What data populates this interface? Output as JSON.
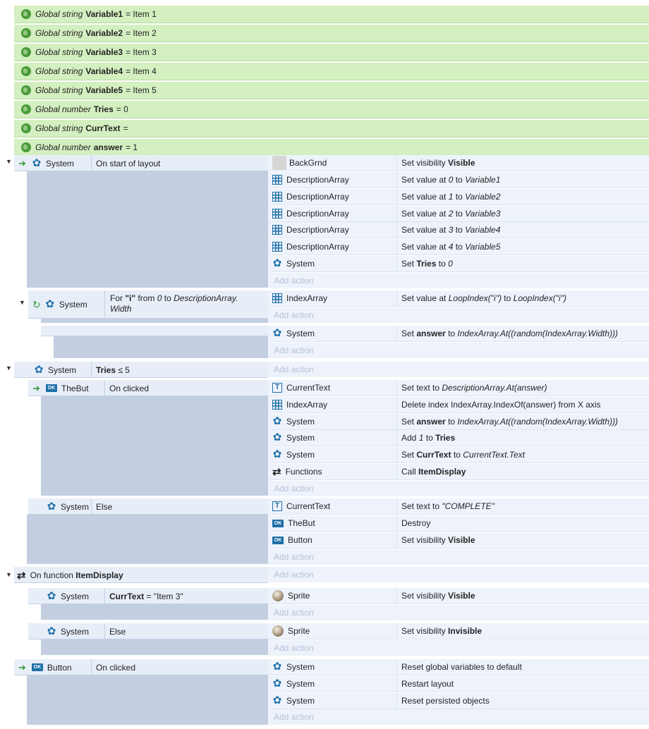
{
  "globals": [
    {
      "type": "Global string",
      "name": "Variable1",
      "value": "= Item 1"
    },
    {
      "type": "Global string",
      "name": "Variable2",
      "value": "= Item 2"
    },
    {
      "type": "Global string",
      "name": "Variable3",
      "value": "= Item 3"
    },
    {
      "type": "Global string",
      "name": "Variable4",
      "value": "= Item 4"
    },
    {
      "type": "Global string",
      "name": "Variable5",
      "value": "= Item 5"
    },
    {
      "type": "Global number",
      "name": "Tries",
      "value": "= 0"
    },
    {
      "type": "Global string",
      "name": "CurrText",
      "value": "="
    },
    {
      "type": "Global number",
      "name": "answer",
      "value": "= 1"
    }
  ],
  "labels": {
    "system": "System",
    "add_action": "Add action",
    "else": "Else",
    "on_clicked": "On clicked",
    "on_start": "On start of layout",
    "thebut": "TheBut",
    "button": "Button",
    "on_function": "On function",
    "item_display": "ItemDisplay",
    "for_pre": "For",
    "for_var": "\"i\"",
    "for_mid": "from",
    "for_zero": "0",
    "for_to": "to",
    "for_width": "DescriptionArray. Width",
    "tries": "Tries",
    "tries_cmp": "≤ 5",
    "currtext": "CurrText",
    "currtext_cmp": "= \"Item 3\""
  },
  "objects": {
    "backgrnd": "BackGrnd",
    "descarray": "DescriptionArray",
    "system": "System",
    "indexarray": "IndexArray",
    "currenttext": "CurrentText",
    "functions": "Functions",
    "thebut": "TheBut",
    "button": "Button",
    "sprite": "Sprite"
  },
  "actions": {
    "a1": {
      "t1": "Set visibility",
      "b1": "Visible"
    },
    "a2": {
      "t1": "Set value at",
      "i1": "0",
      "t2": "to",
      "i2": "Variable1"
    },
    "a3": {
      "t1": "Set value at",
      "i1": "1",
      "t2": "to",
      "i2": "Variable2"
    },
    "a4": {
      "t1": "Set value at",
      "i1": "2",
      "t2": "to",
      "i2": "Variable3"
    },
    "a5": {
      "t1": "Set value at",
      "i1": "3",
      "t2": "to",
      "i2": "Variable4"
    },
    "a6": {
      "t1": "Set value at",
      "i1": "4",
      "t2": "to",
      "i2": "Variable5"
    },
    "a7": {
      "t1": "Set",
      "b1": "Tries",
      "t2": "to",
      "i1": "0"
    },
    "a8": {
      "t1": "Set value at",
      "i1": "LoopIndex(\"i\")",
      "t2": "to",
      "i2": "LoopIndex(\"i\")"
    },
    "a9": {
      "t1": "Set",
      "b1": "answer",
      "t2": "to",
      "i1": "IndexArray.At((random(IndexArray.Width)))"
    },
    "a10": {
      "t1": "Set text to",
      "i1": "DescriptionArray.At(answer)"
    },
    "a11": {
      "t1": "Delete index IndexArray.IndexOf(answer) from X axis"
    },
    "a12": {
      "t1": "Set",
      "b1": "answer",
      "t2": "to",
      "i1": "IndexArray.At((random(IndexArray.Width)))"
    },
    "a13": {
      "t1": "Add",
      "i1": "1",
      "t2": "to",
      "b1": "Tries"
    },
    "a14": {
      "t1": "Set",
      "b1": "CurrText",
      "t2": "to",
      "i1": "CurrentText.Text"
    },
    "a15": {
      "t1": "Call",
      "b1": "ItemDisplay"
    },
    "a16": {
      "t1": "Set text to",
      "i1": "\"COMPLETE\""
    },
    "a17": {
      "t1": "Destroy"
    },
    "a18": {
      "t1": "Set visibility",
      "b1": "Visible"
    },
    "a19": {
      "t1": "Set visibility",
      "b1": "Visible"
    },
    "a20": {
      "t1": "Set visibility",
      "b1": "Invisible"
    },
    "a21": {
      "t1": "Reset global variables to default"
    },
    "a22": {
      "t1": "Restart layout"
    },
    "a23": {
      "t1": "Reset persisted objects"
    }
  }
}
